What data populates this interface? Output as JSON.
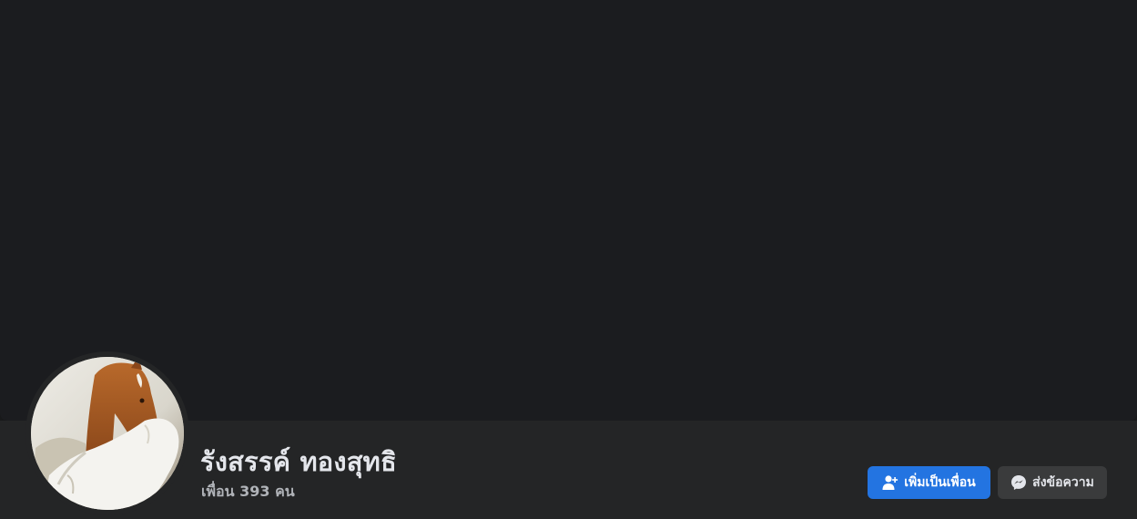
{
  "cover": {
    "color": "#1b1c1f"
  },
  "profile": {
    "name": "รังสรรค์ ทองสุทธิ",
    "friends_text": "เพื่อน 393 คน",
    "avatar_icon": "horse-photo-icon"
  },
  "actions": {
    "add_friend_label": "เพิ่มเป็นเพื่อน",
    "add_friend_icon": "add-person-icon",
    "message_label": "ส่งข้อความ",
    "message_icon": "messenger-icon"
  },
  "colors": {
    "primary": "#2374e1",
    "secondary_button": "#3a3b3c",
    "surface": "#242526",
    "text_primary": "#e4e6eb",
    "text_secondary": "#b0b3b8"
  }
}
